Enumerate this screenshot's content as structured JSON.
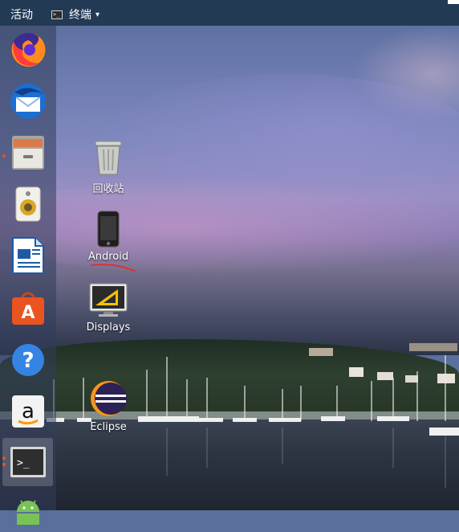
{
  "topbar": {
    "activities_label": "活动",
    "app_menu_label": "终端",
    "app_menu_icon_text": ">_",
    "app_menu_caret": "▾"
  },
  "dock": {
    "items": [
      {
        "name": "firefox-icon",
        "running": false
      },
      {
        "name": "thunderbird-icon",
        "running": false
      },
      {
        "name": "files-icon",
        "running": true
      },
      {
        "name": "rhythmbox-icon",
        "running": false
      },
      {
        "name": "libreoffice-writer-icon",
        "running": false
      },
      {
        "name": "ubuntu-software-icon",
        "running": false
      },
      {
        "name": "help-icon",
        "running": false
      },
      {
        "name": "amazon-icon",
        "running": false,
        "label": "a"
      },
      {
        "name": "terminal-icon",
        "running": true,
        "label": ">_"
      },
      {
        "name": "android-icon",
        "running": false
      }
    ]
  },
  "desktop": {
    "icons": [
      {
        "name": "trash-icon",
        "label": "回收站"
      },
      {
        "name": "android-phone-icon",
        "label": "Android"
      },
      {
        "name": "displays-icon",
        "label": "Displays"
      },
      {
        "name": "eclipse-icon",
        "label": "Eclipse"
      }
    ]
  },
  "colors": {
    "topbar": "#233a55",
    "ubuntu_orange": "#e95420",
    "annotation_red": "#e03030"
  }
}
